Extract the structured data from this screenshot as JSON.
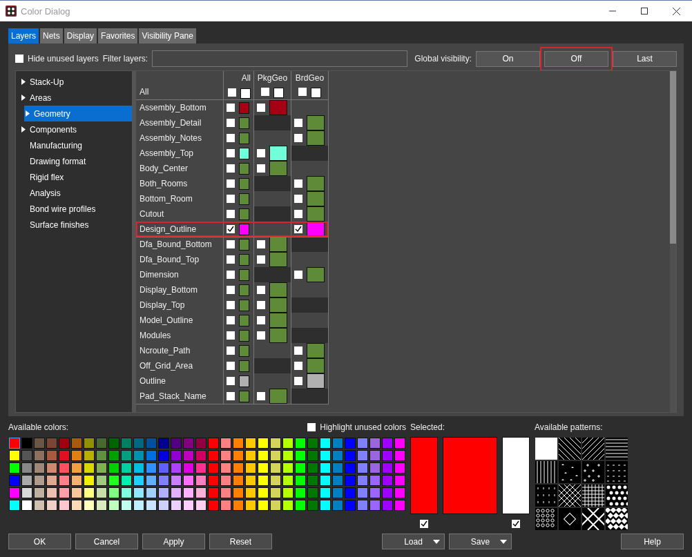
{
  "window": {
    "title": "Color Dialog"
  },
  "tabs": [
    {
      "label": "Layers",
      "selected": true
    },
    {
      "label": "Nets",
      "selected": false
    },
    {
      "label": "Display",
      "selected": false
    },
    {
      "label": "Favorites",
      "selected": false
    },
    {
      "label": "Visibility Pane",
      "selected": false
    }
  ],
  "filter_bar": {
    "hide_unused": {
      "label": "Hide unused layers",
      "checked": false
    },
    "filter_label": "Filter layers:",
    "global_label": "Global visibility:",
    "global_buttons": [
      {
        "label": "On",
        "annotated": false
      },
      {
        "label": "Off",
        "annotated": true
      },
      {
        "label": "Last",
        "annotated": false
      }
    ]
  },
  "sidebar": {
    "items": [
      {
        "label": "Stack-Up",
        "kind": "group",
        "selected": false
      },
      {
        "label": "Areas",
        "kind": "group",
        "selected": false
      },
      {
        "label": "Geometry",
        "kind": "group",
        "selected": true
      },
      {
        "label": "Components",
        "kind": "group",
        "selected": false
      },
      {
        "label": "Manufacturing",
        "kind": "leaf",
        "selected": false
      },
      {
        "label": "Drawing format",
        "kind": "leaf",
        "selected": false
      },
      {
        "label": "Rigid flex",
        "kind": "leaf",
        "selected": false
      },
      {
        "label": "Analysis",
        "kind": "leaf",
        "selected": false
      },
      {
        "label": "Bond wire profiles",
        "kind": "leaf",
        "selected": false
      },
      {
        "label": "Surface finishes",
        "kind": "leaf",
        "selected": false
      }
    ]
  },
  "table": {
    "columns": [
      "All",
      "PkgGeo",
      "BrdGeo"
    ],
    "all_row": {
      "name": "All",
      "cells": [
        {
          "checked": false,
          "color": "#ffffff"
        },
        {
          "checked": false,
          "color": "#ffffff"
        },
        {
          "checked": false,
          "color": "#ffffff"
        }
      ]
    },
    "rows": [
      {
        "name": "Assembly_Bottom",
        "annotated": false,
        "cells": [
          {
            "checked": false,
            "color": "#a50014"
          },
          {
            "checked": false,
            "color": "#a50014"
          },
          null
        ]
      },
      {
        "name": "Assembly_Detail",
        "annotated": false,
        "cells": [
          {
            "checked": false,
            "color": "#5f8a38"
          },
          null,
          {
            "checked": false,
            "color": "#5f8a38"
          }
        ]
      },
      {
        "name": "Assembly_Notes",
        "annotated": false,
        "cells": [
          {
            "checked": false,
            "color": "#5f8a38"
          },
          null,
          {
            "checked": false,
            "color": "#5f8a38"
          }
        ]
      },
      {
        "name": "Assembly_Top",
        "annotated": false,
        "cells": [
          {
            "checked": false,
            "color": "#70ffd8"
          },
          {
            "checked": false,
            "color": "#70ffd8"
          },
          null
        ]
      },
      {
        "name": "Body_Center",
        "annotated": false,
        "cells": [
          {
            "checked": false,
            "color": "#5f8a38"
          },
          {
            "checked": false,
            "color": "#5f8a38"
          },
          null
        ]
      },
      {
        "name": "Both_Rooms",
        "annotated": false,
        "cells": [
          {
            "checked": false,
            "color": "#5f8a38"
          },
          null,
          {
            "checked": false,
            "color": "#5f8a38"
          }
        ]
      },
      {
        "name": "Bottom_Room",
        "annotated": false,
        "cells": [
          {
            "checked": false,
            "color": "#5f8a38"
          },
          null,
          {
            "checked": false,
            "color": "#5f8a38"
          }
        ]
      },
      {
        "name": "Cutout",
        "annotated": false,
        "cells": [
          {
            "checked": false,
            "color": "#5f8a38"
          },
          null,
          {
            "checked": false,
            "color": "#5f8a38"
          }
        ]
      },
      {
        "name": "Design_Outline",
        "annotated": true,
        "cells": [
          {
            "checked": true,
            "color": "#ff00ff"
          },
          null,
          {
            "checked": true,
            "color": "#ff00ff"
          }
        ]
      },
      {
        "name": "Dfa_Bound_Bottom",
        "annotated": false,
        "cells": [
          {
            "checked": false,
            "color": "#5f8a38"
          },
          {
            "checked": false,
            "color": "#5f8a38"
          },
          null
        ]
      },
      {
        "name": "Dfa_Bound_Top",
        "annotated": false,
        "cells": [
          {
            "checked": false,
            "color": "#5f8a38"
          },
          {
            "checked": false,
            "color": "#5f8a38"
          },
          null
        ]
      },
      {
        "name": "Dimension",
        "annotated": false,
        "cells": [
          {
            "checked": false,
            "color": "#5f8a38"
          },
          null,
          {
            "checked": false,
            "color": "#5f8a38"
          }
        ]
      },
      {
        "name": "Display_Bottom",
        "annotated": false,
        "cells": [
          {
            "checked": false,
            "color": "#5f8a38"
          },
          {
            "checked": false,
            "color": "#5f8a38"
          },
          null
        ]
      },
      {
        "name": "Display_Top",
        "annotated": false,
        "cells": [
          {
            "checked": false,
            "color": "#5f8a38"
          },
          {
            "checked": false,
            "color": "#5f8a38"
          },
          null
        ]
      },
      {
        "name": "Model_Outline",
        "annotated": false,
        "cells": [
          {
            "checked": false,
            "color": "#5f8a38"
          },
          {
            "checked": false,
            "color": "#5f8a38"
          },
          null
        ]
      },
      {
        "name": "Modules",
        "annotated": false,
        "cells": [
          {
            "checked": false,
            "color": "#5f8a38"
          },
          {
            "checked": false,
            "color": "#5f8a38"
          },
          null
        ]
      },
      {
        "name": "Ncroute_Path",
        "annotated": false,
        "cells": [
          {
            "checked": false,
            "color": "#5f8a38"
          },
          null,
          {
            "checked": false,
            "color": "#5f8a38"
          }
        ]
      },
      {
        "name": "Off_Grid_Area",
        "annotated": false,
        "cells": [
          {
            "checked": false,
            "color": "#5f8a38"
          },
          null,
          {
            "checked": false,
            "color": "#5f8a38"
          }
        ]
      },
      {
        "name": "Outline",
        "annotated": false,
        "cells": [
          {
            "checked": false,
            "color": "#b0b0b0"
          },
          null,
          {
            "checked": false,
            "color": "#b0b0b0"
          }
        ]
      },
      {
        "name": "Pad_Stack_Name",
        "annotated": false,
        "cells": [
          {
            "checked": false,
            "color": "#5f8a38"
          },
          {
            "checked": false,
            "color": "#5f8a38"
          },
          null
        ]
      }
    ]
  },
  "colors": {
    "label": "Available colors:",
    "highlight_unused": {
      "label": "Highlight unused colors",
      "checked": false
    },
    "rows": [
      [
        {
          "color": "#ff0000",
          "selected": true
        },
        {
          "color": "#000000",
          "selected": false
        },
        {
          "color": "#6b5545",
          "selected": false
        },
        {
          "color": "#7a4535",
          "selected": false
        },
        {
          "color": "#a00010",
          "selected": false
        },
        {
          "color": "#a85a10",
          "selected": false
        },
        {
          "color": "#909000",
          "selected": false
        },
        {
          "color": "#486830",
          "selected": false
        },
        {
          "color": "#006400",
          "selected": false
        },
        {
          "color": "#008060",
          "selected": false
        },
        {
          "color": "#006880",
          "selected": false
        },
        {
          "color": "#0050a0",
          "selected": false
        },
        {
          "color": "#000090",
          "selected": false
        },
        {
          "color": "#500080",
          "selected": false
        },
        {
          "color": "#800080",
          "selected": false
        },
        {
          "color": "#900040",
          "selected": false
        },
        {
          "color": "#ff0000",
          "selected": false
        },
        {
          "color": "#ff8080",
          "selected": false
        },
        {
          "color": "#ff8000",
          "selected": false
        },
        {
          "color": "#ffc800",
          "selected": false
        },
        {
          "color": "#ffff00",
          "selected": false
        },
        {
          "color": "#d4d45a",
          "selected": false
        },
        {
          "color": "#b4ff00",
          "selected": false
        },
        {
          "color": "#00ff00",
          "selected": false
        },
        {
          "color": "#007800",
          "selected": false
        },
        {
          "color": "#00ffff",
          "selected": false
        },
        {
          "color": "#0080c0",
          "selected": false
        },
        {
          "color": "#0000ff",
          "selected": false
        },
        {
          "color": "#8080ff",
          "selected": false
        },
        {
          "color": "#9966e0",
          "selected": false
        },
        {
          "color": "#a000ff",
          "selected": false
        },
        {
          "color": "#ff00ff",
          "selected": false
        }
      ],
      [
        {
          "color": "#ffff00",
          "selected": false
        },
        {
          "color": "#555555",
          "selected": false
        },
        {
          "color": "#8c7060",
          "selected": false
        },
        {
          "color": "#a85a40",
          "selected": false
        },
        {
          "color": "#e01020",
          "selected": false
        },
        {
          "color": "#e08010",
          "selected": false
        },
        {
          "color": "#b8b000",
          "selected": false
        },
        {
          "color": "#609040",
          "selected": false
        },
        {
          "color": "#00a000",
          "selected": false
        },
        {
          "color": "#00a080",
          "selected": false
        },
        {
          "color": "#0090b0",
          "selected": false
        },
        {
          "color": "#0070e0",
          "selected": false
        },
        {
          "color": "#0000e0",
          "selected": false
        },
        {
          "color": "#9000d0",
          "selected": false
        },
        {
          "color": "#c000c0",
          "selected": false
        },
        {
          "color": "#d00060",
          "selected": false
        },
        {
          "color": "#ff0000",
          "selected": false
        },
        {
          "color": "#ff8080",
          "selected": false
        },
        {
          "color": "#ff8000",
          "selected": false
        },
        {
          "color": "#ffc800",
          "selected": false
        },
        {
          "color": "#ffff00",
          "selected": false
        },
        {
          "color": "#d4d45a",
          "selected": false
        },
        {
          "color": "#b4ff00",
          "selected": false
        },
        {
          "color": "#00ff00",
          "selected": false
        },
        {
          "color": "#007800",
          "selected": false
        },
        {
          "color": "#00ffff",
          "selected": false
        },
        {
          "color": "#0080c0",
          "selected": false
        },
        {
          "color": "#0000ff",
          "selected": false
        },
        {
          "color": "#8080ff",
          "selected": false
        },
        {
          "color": "#9966e0",
          "selected": false
        },
        {
          "color": "#a000ff",
          "selected": false
        },
        {
          "color": "#ff00ff",
          "selected": false
        }
      ],
      [
        {
          "color": "#00ff00",
          "selected": false
        },
        {
          "color": "#888888",
          "selected": false
        },
        {
          "color": "#a08878",
          "selected": false
        },
        {
          "color": "#d08870",
          "selected": false
        },
        {
          "color": "#ff5060",
          "selected": false
        },
        {
          "color": "#f0a040",
          "selected": false
        },
        {
          "color": "#d8d800",
          "selected": false
        },
        {
          "color": "#80b050",
          "selected": false
        },
        {
          "color": "#00d000",
          "selected": false
        },
        {
          "color": "#00d0a0",
          "selected": false
        },
        {
          "color": "#00c0e0",
          "selected": false
        },
        {
          "color": "#3090ff",
          "selected": false
        },
        {
          "color": "#6060ff",
          "selected": false
        },
        {
          "color": "#b040ff",
          "selected": false
        },
        {
          "color": "#e000e0",
          "selected": false
        },
        {
          "color": "#ff3090",
          "selected": false
        },
        {
          "color": "#ff0000",
          "selected": false
        },
        {
          "color": "#ff8080",
          "selected": false
        },
        {
          "color": "#ff8000",
          "selected": false
        },
        {
          "color": "#ffc800",
          "selected": false
        },
        {
          "color": "#ffff00",
          "selected": false
        },
        {
          "color": "#d4d45a",
          "selected": false
        },
        {
          "color": "#b4ff00",
          "selected": false
        },
        {
          "color": "#00ff00",
          "selected": false
        },
        {
          "color": "#007800",
          "selected": false
        },
        {
          "color": "#00ffff",
          "selected": false
        },
        {
          "color": "#0080c0",
          "selected": false
        },
        {
          "color": "#0000ff",
          "selected": false
        },
        {
          "color": "#8080ff",
          "selected": false
        },
        {
          "color": "#9966e0",
          "selected": false
        },
        {
          "color": "#a000ff",
          "selected": false
        },
        {
          "color": "#ff00ff",
          "selected": false
        }
      ],
      [
        {
          "color": "#0000ff",
          "selected": false
        },
        {
          "color": "#aaaaaa",
          "selected": false
        },
        {
          "color": "#b09c8c",
          "selected": false
        },
        {
          "color": "#e0a890",
          "selected": false
        },
        {
          "color": "#ff8088",
          "selected": false
        },
        {
          "color": "#f4b070",
          "selected": false
        },
        {
          "color": "#f0f000",
          "selected": false
        },
        {
          "color": "#a0c880",
          "selected": false
        },
        {
          "color": "#20ff20",
          "selected": false
        },
        {
          "color": "#00f0b0",
          "selected": false
        },
        {
          "color": "#20d0ff",
          "selected": false
        },
        {
          "color": "#60b0ff",
          "selected": false
        },
        {
          "color": "#8080ff",
          "selected": false
        },
        {
          "color": "#c880ff",
          "selected": false
        },
        {
          "color": "#ff70ff",
          "selected": false
        },
        {
          "color": "#ff80c0",
          "selected": false
        },
        {
          "color": "#ff0000",
          "selected": false
        },
        {
          "color": "#ff8080",
          "selected": false
        },
        {
          "color": "#ff8000",
          "selected": false
        },
        {
          "color": "#ffc800",
          "selected": false
        },
        {
          "color": "#ffff00",
          "selected": false
        },
        {
          "color": "#d4d45a",
          "selected": false
        },
        {
          "color": "#b4ff00",
          "selected": false
        },
        {
          "color": "#00ff00",
          "selected": false
        },
        {
          "color": "#007800",
          "selected": false
        },
        {
          "color": "#00ffff",
          "selected": false
        },
        {
          "color": "#0080c0",
          "selected": false
        },
        {
          "color": "#0000ff",
          "selected": false
        },
        {
          "color": "#8080ff",
          "selected": false
        },
        {
          "color": "#9a66ff",
          "selected": false
        },
        {
          "color": "#a000ff",
          "selected": false
        },
        {
          "color": "#ff00ff",
          "selected": false
        }
      ],
      [
        {
          "color": "#ff00ff",
          "selected": false
        },
        {
          "color": "#d8d8d8",
          "selected": false
        },
        {
          "color": "#c0b0a0",
          "selected": false
        },
        {
          "color": "#ecc0b0",
          "selected": false
        },
        {
          "color": "#ffa0a8",
          "selected": false
        },
        {
          "color": "#f8c898",
          "selected": false
        },
        {
          "color": "#ffff80",
          "selected": false
        },
        {
          "color": "#c8e0a8",
          "selected": false
        },
        {
          "color": "#80ff80",
          "selected": false
        },
        {
          "color": "#80ffe0",
          "selected": false
        },
        {
          "color": "#90e8ff",
          "selected": false
        },
        {
          "color": "#a0d0ff",
          "selected": false
        },
        {
          "color": "#b0b0ff",
          "selected": false
        },
        {
          "color": "#e0b0ff",
          "selected": false
        },
        {
          "color": "#ffb0ff",
          "selected": false
        },
        {
          "color": "#ffb0d8",
          "selected": false
        },
        {
          "color": "#ff0000",
          "selected": false
        },
        {
          "color": "#ff8080",
          "selected": false
        },
        {
          "color": "#ff8000",
          "selected": false
        },
        {
          "color": "#ffc800",
          "selected": false
        },
        {
          "color": "#ffff00",
          "selected": false
        },
        {
          "color": "#d4d45a",
          "selected": false
        },
        {
          "color": "#b4ff00",
          "selected": false
        },
        {
          "color": "#00ff00",
          "selected": false
        },
        {
          "color": "#007800",
          "selected": false
        },
        {
          "color": "#00ffff",
          "selected": false
        },
        {
          "color": "#0080c0",
          "selected": false
        },
        {
          "color": "#0000ff",
          "selected": false
        },
        {
          "color": "#8080ff",
          "selected": false
        },
        {
          "color": "#9a66ff",
          "selected": false
        },
        {
          "color": "#a000ff",
          "selected": false
        },
        {
          "color": "#ff00ff",
          "selected": false
        }
      ],
      [
        {
          "color": "#00ffff",
          "selected": false
        },
        {
          "color": "#ffffff",
          "selected": false
        },
        {
          "color": "#d0c0b0",
          "selected": false
        },
        {
          "color": "#f0d0c8",
          "selected": false
        },
        {
          "color": "#ffc8d0",
          "selected": false
        },
        {
          "color": "#fcdcb8",
          "selected": false
        },
        {
          "color": "#ffffc0",
          "selected": false
        },
        {
          "color": "#d8ecc0",
          "selected": false
        },
        {
          "color": "#c0ffc0",
          "selected": false
        },
        {
          "color": "#c0fff0",
          "selected": false
        },
        {
          "color": "#c0f0ff",
          "selected": false
        },
        {
          "color": "#c8e4ff",
          "selected": false
        },
        {
          "color": "#d0d0ff",
          "selected": false
        },
        {
          "color": "#ecd0ff",
          "selected": false
        },
        {
          "color": "#ffd0ff",
          "selected": false
        },
        {
          "color": "#ffd0f0",
          "selected": false
        },
        {
          "color": "#ff0000",
          "selected": false
        },
        {
          "color": "#ff8080",
          "selected": false
        },
        {
          "color": "#ff8000",
          "selected": false
        },
        {
          "color": "#ffc800",
          "selected": false
        },
        {
          "color": "#ffff00",
          "selected": false
        },
        {
          "color": "#d4d45a",
          "selected": false
        },
        {
          "color": "#b4ff00",
          "selected": false
        },
        {
          "color": "#00ff00",
          "selected": false
        },
        {
          "color": "#007800",
          "selected": false
        },
        {
          "color": "#00ffff",
          "selected": false
        },
        {
          "color": "#0080c0",
          "selected": false
        },
        {
          "color": "#0000ff",
          "selected": false
        },
        {
          "color": "#8080ff",
          "selected": false
        },
        {
          "color": "#9a66ff",
          "selected": false
        },
        {
          "color": "#a000ff",
          "selected": false
        },
        {
          "color": "#ff00ff",
          "selected": false
        }
      ]
    ]
  },
  "selected_panel": {
    "label": "Selected:",
    "swatches": [
      {
        "color": "#ff0000",
        "kind": "narrow",
        "checked": true
      },
      {
        "color": "#ff0000",
        "kind": "wide"
      },
      {
        "color": "#ffffff",
        "kind": "narrow",
        "checked": true
      }
    ]
  },
  "patterns": {
    "label": "Available patterns:"
  },
  "buttons": [
    {
      "label": "OK",
      "kind": "plain"
    },
    {
      "label": "Cancel",
      "kind": "plain"
    },
    {
      "label": "Apply",
      "kind": "plain"
    },
    {
      "label": "Reset",
      "kind": "plain"
    },
    {
      "label": "Load",
      "kind": "menu"
    },
    {
      "label": "Save",
      "kind": "menu"
    },
    {
      "label": "Help",
      "kind": "plain"
    }
  ]
}
